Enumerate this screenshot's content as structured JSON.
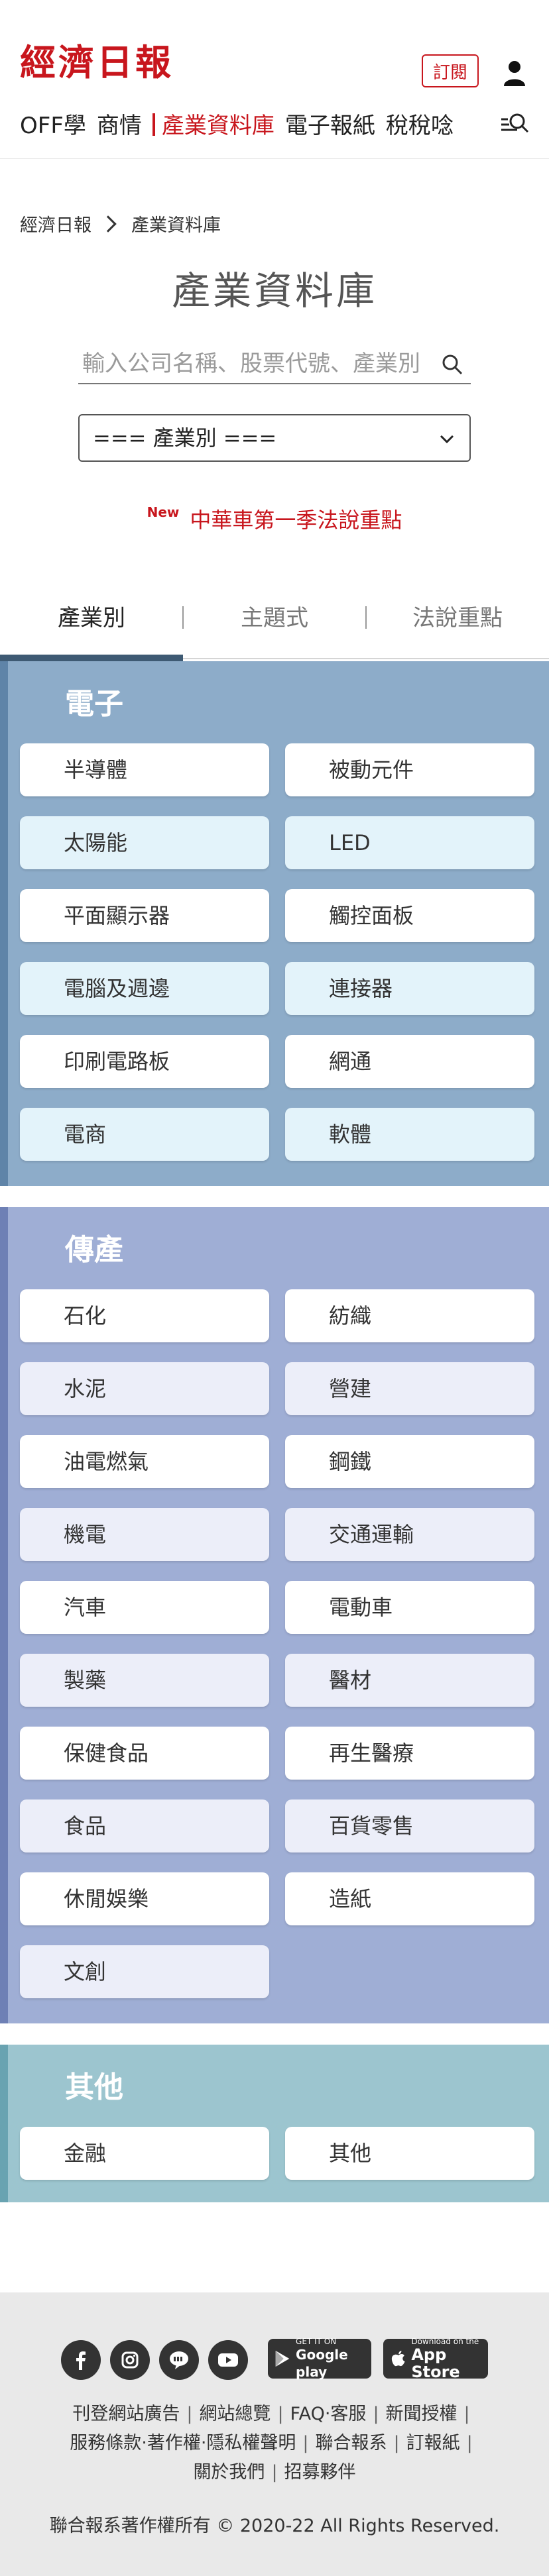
{
  "header": {
    "logo": "經濟日報",
    "subscribe_label": "訂閱",
    "nav": [
      "OFF學",
      "商情",
      "產業資料庫",
      "電子報紙",
      "稅稅唸"
    ],
    "active_nav_index": 2
  },
  "breadcrumb": {
    "home": "經濟日報",
    "current": "產業資料庫"
  },
  "page": {
    "title": "產業資料庫",
    "search_placeholder": "輸入公司名稱、股票代號、產業別",
    "select_value": "=== 產業別 ===",
    "news_badge": "New",
    "news_text": "中華車第一季法說重點"
  },
  "tabs": [
    "產業別",
    "主題式",
    "法說重點"
  ],
  "sections": [
    {
      "title": "電子",
      "items": [
        "半導體",
        "被動元件",
        "太陽能",
        "LED",
        "平面顯示器",
        "觸控面板",
        "電腦及週邊",
        "連接器",
        "印刷電路板",
        "網通",
        "電商",
        "軟體"
      ]
    },
    {
      "title": "傳產",
      "items": [
        "石化",
        "紡織",
        "水泥",
        "營建",
        "油電燃氣",
        "鋼鐵",
        "機電",
        "交通運輸",
        "汽車",
        "電動車",
        "製藥",
        "醫材",
        "保健食品",
        "再生醫療",
        "食品",
        "百貨零售",
        "休閒娛樂",
        "造紙",
        "文創"
      ]
    },
    {
      "title": "其他",
      "items": [
        "金融",
        "其他"
      ]
    }
  ],
  "footer": {
    "google_play_small": "GET IT ON",
    "google_play_big": "Google play",
    "app_store_small": "Download on the",
    "app_store_big": "App Store",
    "links_row1": [
      "刊登網站廣告",
      "網站總覽",
      "FAQ‧客服",
      "新聞授權"
    ],
    "links_row2": [
      "服務條款‧著作權‧隱私權聲明",
      "聯合報系",
      "訂報紙"
    ],
    "links_row3": [
      "關於我們",
      "招募夥伴"
    ],
    "copyright": "聯合報系著作權所有 © 2020-22 All Rights Reserved."
  },
  "colors": {
    "brand_red": "#c8161d",
    "electronics_bg": "#8dacc9",
    "traditional_bg": "#9faed5",
    "other_bg": "#9cc5cf",
    "btn_white": "#ffffff",
    "btn_elec_alt": "#e3f3fa",
    "btn_trad_alt": "#eceef9"
  }
}
